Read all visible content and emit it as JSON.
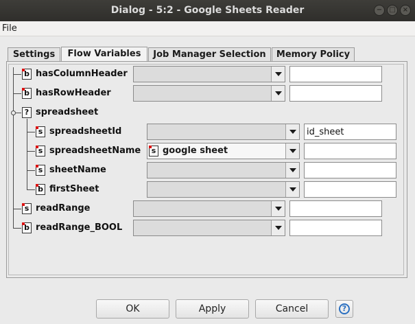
{
  "window": {
    "title": "Dialog - 5:2 - Google Sheets Reader"
  },
  "menu": {
    "file": "File"
  },
  "tabs": [
    "Settings",
    "Flow Variables",
    "Job Manager Selection",
    "Memory Policy"
  ],
  "tree": {
    "rows": [
      {
        "name": "hasColumnHeader",
        "type": "b",
        "combo": "",
        "field": ""
      },
      {
        "name": "hasRowHeader",
        "type": "b",
        "combo": "",
        "field": ""
      },
      {
        "name": "spreadsheet",
        "type": "?"
      },
      {
        "name": "spreadsheetId",
        "type": "s",
        "combo": "",
        "field": "id_sheet"
      },
      {
        "name": "spreadsheetName",
        "type": "s",
        "combo": "google sheet",
        "combo_badge": "s",
        "field": ""
      },
      {
        "name": "sheetName",
        "type": "s",
        "combo": "",
        "field": ""
      },
      {
        "name": "firstSheet",
        "type": "b",
        "combo": "",
        "field": ""
      },
      {
        "name": "readRange",
        "type": "s",
        "combo": "",
        "field": ""
      },
      {
        "name": "readRange_BOOL",
        "type": "b",
        "combo": "",
        "field": ""
      }
    ]
  },
  "buttons": {
    "ok": "OK",
    "apply": "Apply",
    "cancel": "Cancel",
    "help": "?"
  },
  "colors": {
    "titlebar": "#3e3d39",
    "help": "#2a6fc0",
    "badge_dot": "#d11111"
  },
  "icons": {
    "help": "help-icon",
    "close": "close-icon",
    "minimize": "minimize-icon",
    "maximize": "maximize-icon"
  }
}
